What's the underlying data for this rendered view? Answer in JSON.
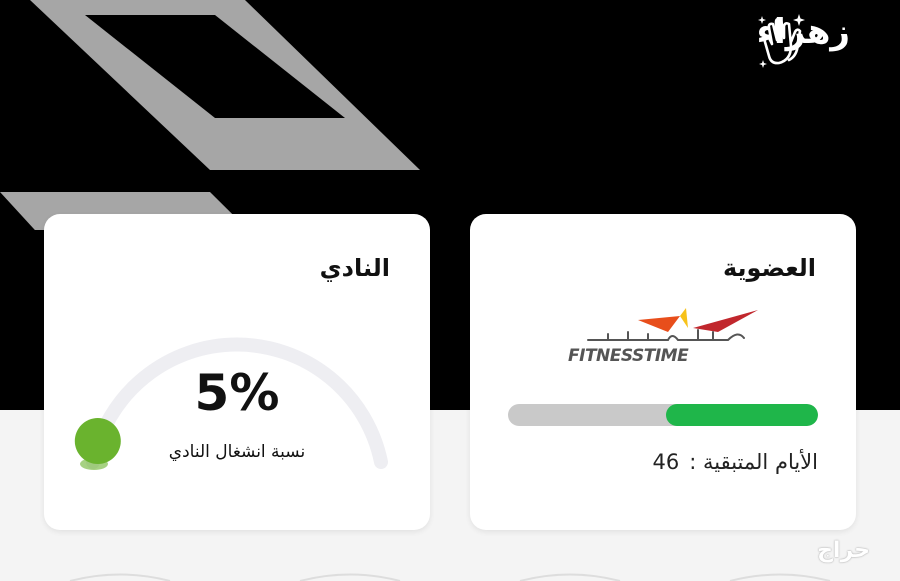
{
  "header": {
    "greeting_name": "زهراء",
    "greeting_icon": "clapping-hands-icon"
  },
  "membership": {
    "title": "العضوية",
    "brand_name": "FITNESSTIME",
    "brand_logo_lettering": "وقت اللياقة",
    "days_label": "الأيام المتبقية :",
    "days_remaining": "46",
    "progress_fraction": 0.49,
    "colors": {
      "progress": "#1fb64a",
      "track": "#c9c9c9"
    }
  },
  "club": {
    "title": "النادي",
    "occupancy_value": "5%",
    "occupancy_fraction": 0.05,
    "occupancy_label": "نسبة انشغال النادي",
    "colors": {
      "indicator": "#6ab32e",
      "gauge_track": "#eeeef2"
    }
  },
  "watermark": "حراج"
}
